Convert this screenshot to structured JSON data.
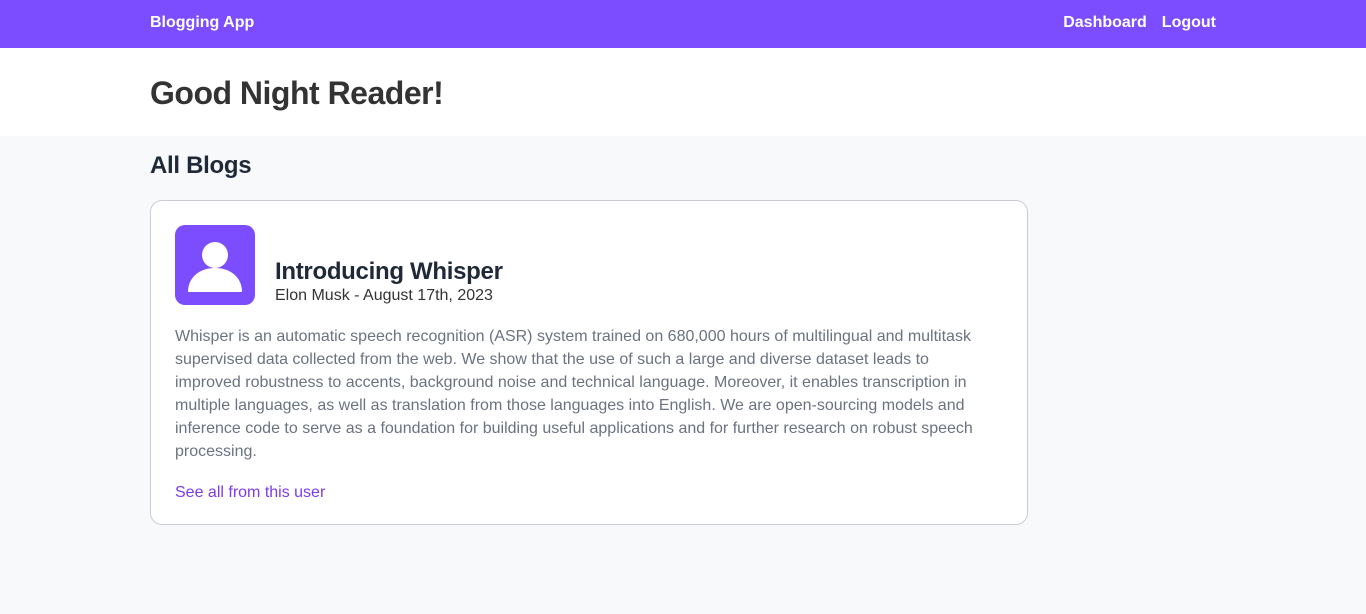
{
  "nav": {
    "brand": "Blogging App",
    "links": [
      "Dashboard",
      "Logout"
    ]
  },
  "greeting": "Good Night Reader!",
  "section_title": "All Blogs",
  "blog": {
    "avatar_icon": "user-icon",
    "title": "Introducing Whisper",
    "meta": "Elon Musk - August 17th, 2023",
    "body": "Whisper is an automatic speech recognition (ASR) system trained on 680,000 hours of multilingual and multitask supervised data collected from the web. We show that the use of such a large and diverse dataset leads to improved robustness to accents, background noise and technical language. Moreover, it enables transcription in multiple languages, as well as translation from those languages into English. We are open-sourcing models and inference code to serve as a foundation for building useful applications and for further research on robust speech processing.",
    "link": "See all from this user"
  },
  "colors": {
    "accent": "#7c4dff",
    "link": "#7c3aed",
    "page_background": "#f8f9fa"
  }
}
